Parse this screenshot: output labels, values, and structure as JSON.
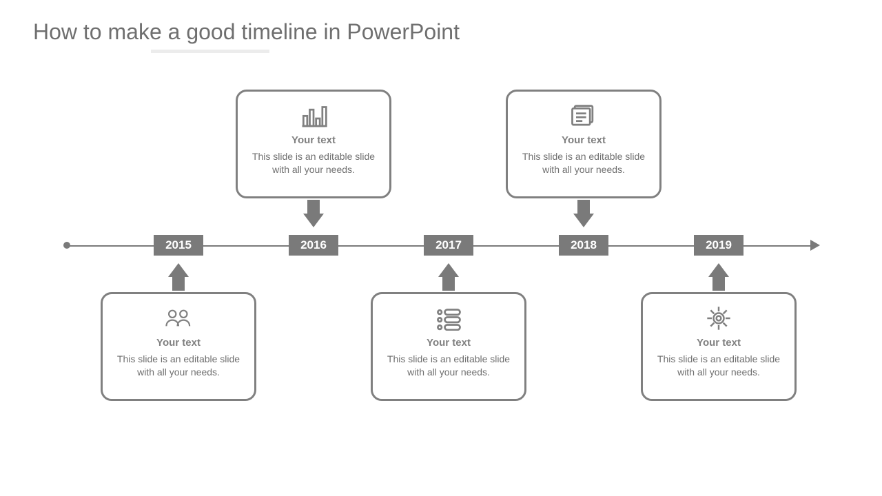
{
  "title": "How to make a good timeline in PowerPoint",
  "colors": {
    "accent": "#7a7a7a",
    "text": "#6f6f6f"
  },
  "timeline": {
    "years": [
      "2015",
      "2016",
      "2017",
      "2018",
      "2019"
    ],
    "cards": [
      {
        "icon": "people-icon",
        "heading": "Your text",
        "body": "This slide is an editable slide with all your needs."
      },
      {
        "icon": "barchart-icon",
        "heading": "Your text",
        "body": "This slide is an editable slide with all your needs."
      },
      {
        "icon": "list-icon",
        "heading": "Your text",
        "body": "This slide is an editable slide with all your needs."
      },
      {
        "icon": "document-icon",
        "heading": "Your text",
        "body": "This slide is an editable slide with all your needs."
      },
      {
        "icon": "gear-icon",
        "heading": "Your text",
        "body": "This slide is an editable slide with all your needs."
      }
    ]
  }
}
